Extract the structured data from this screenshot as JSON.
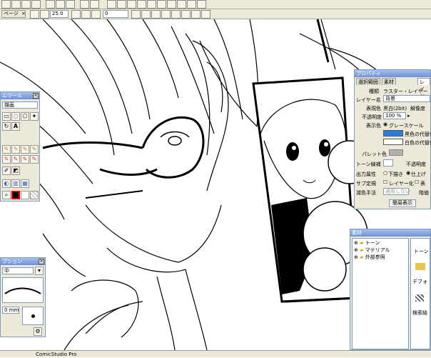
{
  "toolbar": {
    "page_tab": "ページ",
    "zoom_value": "25.0",
    "rotation_value": "0"
  },
  "tools_panel": {
    "title": "ムツール",
    "field_value": "描画"
  },
  "brush_panel": {
    "title": "プション",
    "size_value": "中",
    "mm_value": "0 mm"
  },
  "properties_panel": {
    "title": "プロパティ",
    "tabs": [
      "選択範囲",
      "素材",
      "レイヤ"
    ],
    "rows": {
      "kind_label": "種類",
      "kind_value": "ラスター・レイヤー",
      "name_label": "レイヤー名",
      "name_value": "背景",
      "display_label": "表現色",
      "display_value": "黒白(2bit)",
      "resolution_label": "解像度",
      "opacity_label": "不透明度",
      "opacity_value": "100 %",
      "color_label": "表示色",
      "color_option": "グレースケール",
      "black_label": "黒色の代替色",
      "white_label": "白色の代替色",
      "palette_label": "パレット色",
      "tone_label": "トーン線補",
      "tone_opacity_label": "不透明度",
      "output_label": "出力属性",
      "output_opt1": "下描き",
      "output_opt2": "仕上げ",
      "sub_label": "サブ定規",
      "sub_opt1": "レイヤー化",
      "sub_opt2": "表",
      "reduce_label": "減色手法",
      "reduce_value": "適用しない",
      "reduce_extra": "階値",
      "button": "簡易表示"
    }
  },
  "material_panel": {
    "title": "素材",
    "tree": [
      "トーン",
      "マテリアル",
      "外部参照"
    ],
    "right_items": [
      "トーン",
      "デフォ",
      "検索結"
    ]
  },
  "status_bar": {
    "app_name": "ComicStudio Pro"
  }
}
